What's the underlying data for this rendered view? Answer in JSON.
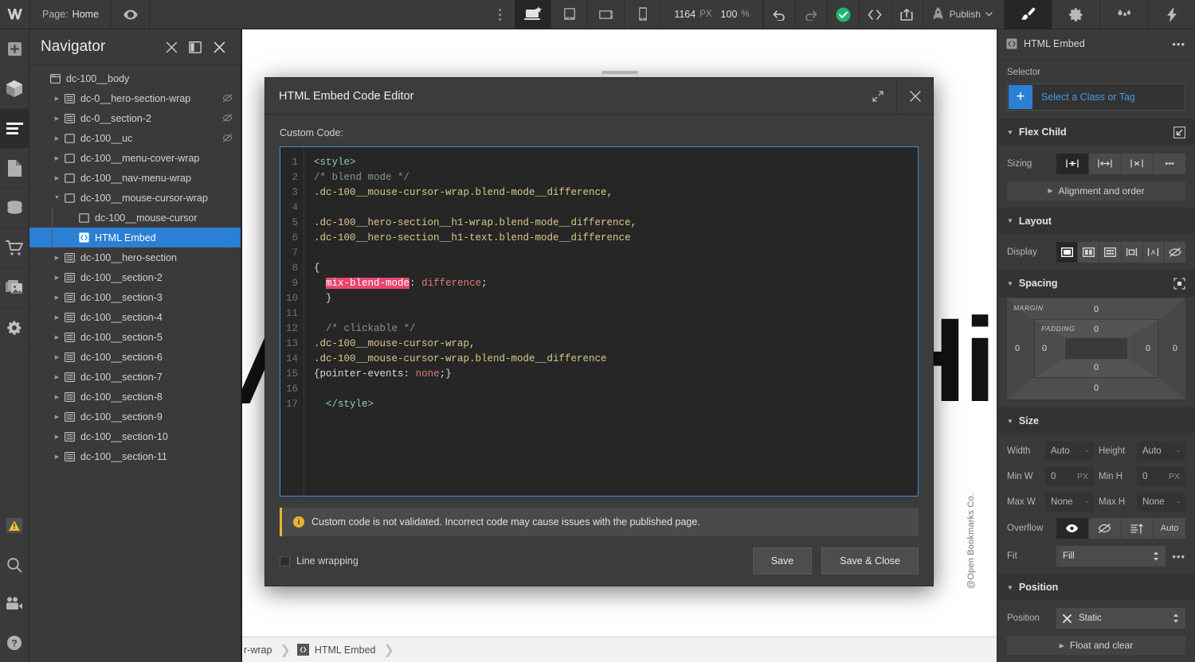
{
  "topbar": {
    "logo": "webflow-logo",
    "page_prefix": "Page:",
    "page_name": "Home",
    "preview_icon": "eye-icon",
    "more_icon": "more-vertical-icon",
    "breakpoints": [
      {
        "name": "desktop-breakpoint",
        "active": true
      },
      {
        "name": "tablet-breakpoint",
        "active": false
      },
      {
        "name": "mobile-landscape-breakpoint",
        "active": false
      },
      {
        "name": "mobile-portrait-breakpoint",
        "active": false
      }
    ],
    "canvas_width": "1164",
    "canvas_width_unit": "PX",
    "zoom_level": "100",
    "zoom_unit": "%",
    "undo_icon": "undo-icon",
    "redo_icon": "redo-icon",
    "status_icon": "check-circle-icon",
    "code_icon": "code-brackets-icon",
    "share_icon": "share-export-icon",
    "rocket_icon": "rocket-icon",
    "publish_label": "Publish",
    "publish_chevron": "chevron-down-icon",
    "panels": [
      {
        "name": "style-panel-tab",
        "icon": "paintbrush-icon",
        "active": true
      },
      {
        "name": "settings-panel-tab",
        "icon": "gear-icon",
        "active": false
      },
      {
        "name": "style-manager-tab",
        "icon": "drops-icon",
        "active": false
      },
      {
        "name": "interactions-panel-tab",
        "icon": "lightning-icon",
        "active": false
      }
    ]
  },
  "rail": {
    "items": [
      {
        "name": "add-elements",
        "icon": "plus-square-icon"
      },
      {
        "name": "components",
        "icon": "cube-icon"
      },
      {
        "name": "navigator",
        "icon": "layers-lines-icon",
        "active": true
      },
      {
        "name": "pages",
        "icon": "page-icon"
      },
      {
        "name": "cms",
        "icon": "database-icon"
      },
      {
        "name": "ecommerce",
        "icon": "cart-icon"
      },
      {
        "name": "assets",
        "icon": "images-icon"
      },
      {
        "name": "site-settings",
        "icon": "gear-icon"
      }
    ],
    "bottom_items": [
      {
        "name": "audit-warning",
        "icon": "warning-triangle-icon"
      },
      {
        "name": "search",
        "icon": "search-icon"
      },
      {
        "name": "video-tutorials",
        "icon": "video-camera-icon"
      },
      {
        "name": "help",
        "icon": "question-circle-icon"
      }
    ]
  },
  "navigator": {
    "title": "Navigator",
    "collapse_icon": "collapse-all-icon",
    "dock_icon": "dock-panel-icon",
    "close_icon": "close-icon",
    "items": [
      {
        "label": "dc-100__body",
        "icon": "body-icon",
        "indent": 0,
        "arrow": "none",
        "hidden_icon": false,
        "selected": false
      },
      {
        "label": "dc-0__hero-section-wrap",
        "icon": "section-icon",
        "indent": 1,
        "arrow": "collapsed",
        "hidden_icon": true,
        "selected": false
      },
      {
        "label": "dc-0__section-2",
        "icon": "section-icon",
        "indent": 1,
        "arrow": "collapsed",
        "hidden_icon": true,
        "selected": false
      },
      {
        "label": "dc-100__uc",
        "icon": "div-icon",
        "indent": 1,
        "arrow": "collapsed",
        "hidden_icon": true,
        "selected": false
      },
      {
        "label": "dc-100__menu-cover-wrap",
        "icon": "div-icon",
        "indent": 1,
        "arrow": "collapsed",
        "hidden_icon": false,
        "selected": false
      },
      {
        "label": "dc-100__nav-menu-wrap",
        "icon": "div-icon",
        "indent": 1,
        "arrow": "collapsed",
        "hidden_icon": false,
        "selected": false
      },
      {
        "label": "dc-100__mouse-cursor-wrap",
        "icon": "div-icon",
        "indent": 1,
        "arrow": "expanded",
        "hidden_icon": false,
        "selected": false
      },
      {
        "label": "dc-100__mouse-cursor",
        "icon": "div-icon",
        "indent": 2,
        "arrow": "none",
        "hidden_icon": false,
        "selected": false
      },
      {
        "label": "HTML Embed",
        "icon": "embed-icon",
        "indent": 2,
        "arrow": "none",
        "hidden_icon": false,
        "selected": true
      },
      {
        "label": "dc-100__hero-section",
        "icon": "section-icon",
        "indent": 1,
        "arrow": "collapsed",
        "hidden_icon": false,
        "selected": false
      },
      {
        "label": "dc-100__section-2",
        "icon": "section-icon",
        "indent": 1,
        "arrow": "collapsed",
        "hidden_icon": false,
        "selected": false
      },
      {
        "label": "dc-100__section-3",
        "icon": "section-icon",
        "indent": 1,
        "arrow": "collapsed",
        "hidden_icon": false,
        "selected": false
      },
      {
        "label": "dc-100__section-4",
        "icon": "section-icon",
        "indent": 1,
        "arrow": "collapsed",
        "hidden_icon": false,
        "selected": false
      },
      {
        "label": "dc-100__section-5",
        "icon": "section-icon",
        "indent": 1,
        "arrow": "collapsed",
        "hidden_icon": false,
        "selected": false
      },
      {
        "label": "dc-100__section-6",
        "icon": "section-icon",
        "indent": 1,
        "arrow": "collapsed",
        "hidden_icon": false,
        "selected": false
      },
      {
        "label": "dc-100__section-7",
        "icon": "section-icon",
        "indent": 1,
        "arrow": "collapsed",
        "hidden_icon": false,
        "selected": false
      },
      {
        "label": "dc-100__section-8",
        "icon": "section-icon",
        "indent": 1,
        "arrow": "collapsed",
        "hidden_icon": false,
        "selected": false
      },
      {
        "label": "dc-100__section-9",
        "icon": "section-icon",
        "indent": 1,
        "arrow": "collapsed",
        "hidden_icon": false,
        "selected": false
      },
      {
        "label": "dc-100__section-10",
        "icon": "section-icon",
        "indent": 1,
        "arrow": "collapsed",
        "hidden_icon": false,
        "selected": false
      },
      {
        "label": "dc-100__section-11",
        "icon": "section-icon",
        "indent": 1,
        "arrow": "collapsed",
        "hidden_icon": false,
        "selected": false
      }
    ]
  },
  "canvas": {
    "hero_left": "/",
    "hero_right": "Hi",
    "watermark": "@Open Bookmarks Co."
  },
  "modal": {
    "title": "HTML Embed Code Editor",
    "expand_icon": "expand-diagonal-icon",
    "close_icon": "close-icon",
    "custom_code_label": "Custom Code:",
    "code_lines": [
      {
        "n": "1",
        "segments": [
          {
            "t": "<style>",
            "c": "tok-tag"
          }
        ]
      },
      {
        "n": "2",
        "segments": [
          {
            "t": "/* blend mode */",
            "c": "tok-com"
          }
        ]
      },
      {
        "n": "3",
        "segments": [
          {
            "t": ".dc-100__mouse-cursor-wrap.blend-mode__difference",
            "c": "tok-sel"
          },
          {
            "t": ",",
            "c": "tok-punct"
          }
        ]
      },
      {
        "n": "4",
        "segments": []
      },
      {
        "n": "5",
        "segments": [
          {
            "t": ".dc-100__hero-section__h1-wrap.blend-mode__difference",
            "c": "tok-sel"
          },
          {
            "t": ",",
            "c": "tok-punct"
          }
        ]
      },
      {
        "n": "6",
        "segments": [
          {
            "t": ".dc-100__hero-section__h1-text.blend-mode__difference",
            "c": "tok-sel"
          }
        ]
      },
      {
        "n": "7",
        "segments": []
      },
      {
        "n": "8",
        "segments": [
          {
            "t": "{",
            "c": "tok-punct"
          }
        ]
      },
      {
        "n": "9",
        "segments": [
          {
            "t": "  ",
            "c": "tok-punct"
          },
          {
            "t": "mix-blend-mode",
            "c": "tok-hl"
          },
          {
            "t": ": ",
            "c": "tok-punct"
          },
          {
            "t": "difference",
            "c": "tok-val"
          },
          {
            "t": ";",
            "c": "tok-punct"
          }
        ]
      },
      {
        "n": "10",
        "segments": [
          {
            "t": "  }",
            "c": "tok-punct"
          }
        ]
      },
      {
        "n": "11",
        "segments": []
      },
      {
        "n": "12",
        "segments": [
          {
            "t": "  /* clickable */",
            "c": "tok-com"
          }
        ]
      },
      {
        "n": "13",
        "segments": [
          {
            "t": ".dc-100__mouse-cursor-wrap",
            "c": "tok-sel"
          },
          {
            "t": ",",
            "c": "tok-punct"
          }
        ]
      },
      {
        "n": "14",
        "segments": [
          {
            "t": ".dc-100__mouse-cursor-wrap.blend-mode__difference",
            "c": "tok-sel"
          }
        ]
      },
      {
        "n": "15",
        "segments": [
          {
            "t": "{",
            "c": "tok-punct"
          },
          {
            "t": "pointer-events",
            "c": "tok-prop"
          },
          {
            "t": ": ",
            "c": "tok-punct"
          },
          {
            "t": "none",
            "c": "tok-val"
          },
          {
            "t": ";}",
            "c": "tok-punct"
          }
        ]
      },
      {
        "n": "16",
        "segments": []
      },
      {
        "n": "17",
        "segments": [
          {
            "t": "  </style>",
            "c": "tok-tag"
          }
        ]
      }
    ],
    "warning_icon": "info-icon",
    "warning_text": "Custom code is not validated. Incorrect code may cause issues with the published page.",
    "line_wrapping_label": "Line wrapping",
    "line_wrapping_checked": false,
    "save_label": "Save",
    "save_close_label": "Save & Close"
  },
  "right_panel": {
    "header": {
      "icon": "embed-icon",
      "title": "HTML Embed",
      "more_icon": "more-horizontal-icon"
    },
    "selector": {
      "label": "Selector",
      "plus_icon": "plus-icon",
      "placeholder": "Select a Class or Tag"
    },
    "flex_child": {
      "title": "Flex Child",
      "corner_icon": "arrow-corner-icon",
      "sizing_label": "Sizing",
      "sizing_options": [
        {
          "name": "sizing-shrink",
          "icon": "shrink-icon",
          "active": true
        },
        {
          "name": "sizing-grow",
          "icon": "grow-icon",
          "active": false
        },
        {
          "name": "sizing-none",
          "icon": "no-shrink-icon",
          "active": false
        },
        {
          "name": "sizing-more",
          "icon": "more-horizontal-icon",
          "active": false
        }
      ],
      "alignment_row": "Alignment and order"
    },
    "layout": {
      "title": "Layout",
      "display_label": "Display",
      "display_options": [
        {
          "name": "display-block",
          "icon": "block-icon",
          "active": true
        },
        {
          "name": "display-flex",
          "icon": "flex-icon",
          "active": false
        },
        {
          "name": "display-grid",
          "icon": "grid-icon",
          "active": false
        },
        {
          "name": "display-inline-block",
          "icon": "inline-block-icon",
          "active": false
        },
        {
          "name": "display-inline",
          "icon": "inline-icon",
          "active": false
        },
        {
          "name": "display-none",
          "icon": "none-icon",
          "active": false
        }
      ]
    },
    "spacing": {
      "title": "Spacing",
      "mode_icon": "spacing-mode-icon",
      "margin_label": "MARGIN",
      "padding_label": "PADDING",
      "margin": {
        "top": "0",
        "right": "0",
        "bottom": "0",
        "left": "0"
      },
      "padding": {
        "top": "0",
        "right": "0",
        "bottom": "0",
        "left": "0"
      }
    },
    "size": {
      "title": "Size",
      "fields": [
        {
          "label": "Width",
          "value": "Auto",
          "unit": "-",
          "name": "width-field"
        },
        {
          "label": "Height",
          "value": "Auto",
          "unit": "-",
          "name": "height-field"
        },
        {
          "label": "Min W",
          "value": "0",
          "unit": "PX",
          "name": "min-width-field"
        },
        {
          "label": "Min H",
          "value": "0",
          "unit": "PX",
          "name": "min-height-field"
        },
        {
          "label": "Max W",
          "value": "None",
          "unit": "-",
          "name": "max-width-field"
        },
        {
          "label": "Max H",
          "value": "None",
          "unit": "-",
          "name": "max-height-field"
        }
      ],
      "overflow_label": "Overflow",
      "overflow_options": [
        {
          "name": "overflow-visible",
          "icon": "eye-icon",
          "label": "",
          "active": true
        },
        {
          "name": "overflow-hidden",
          "icon": "eye-slash-icon",
          "label": "",
          "active": false
        },
        {
          "name": "overflow-scroll",
          "icon": "scroll-icon",
          "label": "",
          "active": false
        },
        {
          "name": "overflow-auto",
          "icon": "",
          "label": "Auto",
          "active": false
        }
      ],
      "fit_label": "Fit",
      "fit_value": "Fill",
      "fit_more_icon": "more-horizontal-icon"
    },
    "position": {
      "title": "Position",
      "position_label": "Position",
      "clear_icon": "close-icon",
      "position_value": "Static",
      "float_row": "Float and clear"
    }
  },
  "breadcrumb": {
    "items": [
      {
        "label": "r-wrap",
        "icon": "",
        "name": "breadcrumb-parent"
      },
      {
        "label": "HTML Embed",
        "icon": "embed-icon",
        "name": "breadcrumb-current"
      }
    ]
  }
}
